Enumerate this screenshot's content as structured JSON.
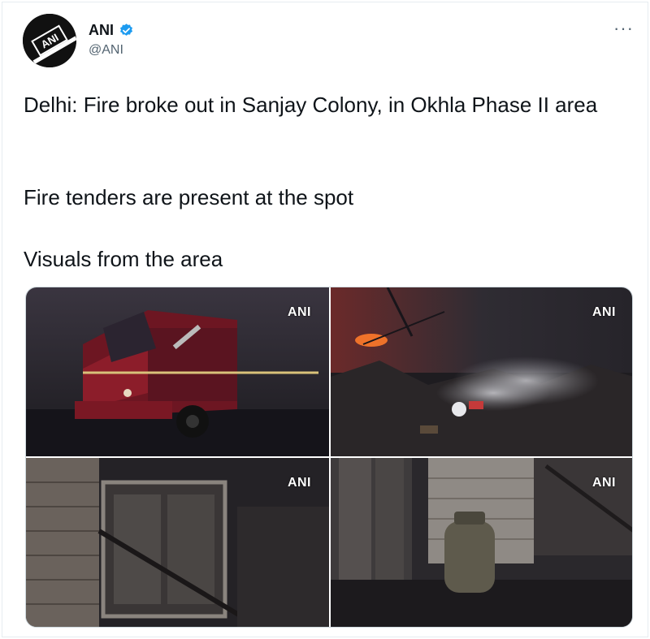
{
  "tweet": {
    "author": {
      "name": "ANI",
      "handle": "@ANI",
      "verified": true,
      "avatar_logo_text": "ANI"
    },
    "more_icon": "more-horizontal-icon",
    "text_lines": [
      "Delhi: Fire broke out in Sanjay Colony, in Okhla Phase II area",
      "Fire tenders are present at the spot",
      "Visuals from the area"
    ],
    "media": [
      {
        "description_icon": "fire-tender-photo",
        "watermark": "ANI"
      },
      {
        "description_icon": "burning-debris-photo",
        "watermark": "ANI"
      },
      {
        "description_icon": "burnt-doorway-photo",
        "watermark": "ANI"
      },
      {
        "description_icon": "gas-cylinder-photo",
        "watermark": "ANI"
      }
    ]
  },
  "colors": {
    "verified_blue": "#1d9bf0",
    "text_primary": "#0f1419",
    "text_secondary": "#536471"
  }
}
